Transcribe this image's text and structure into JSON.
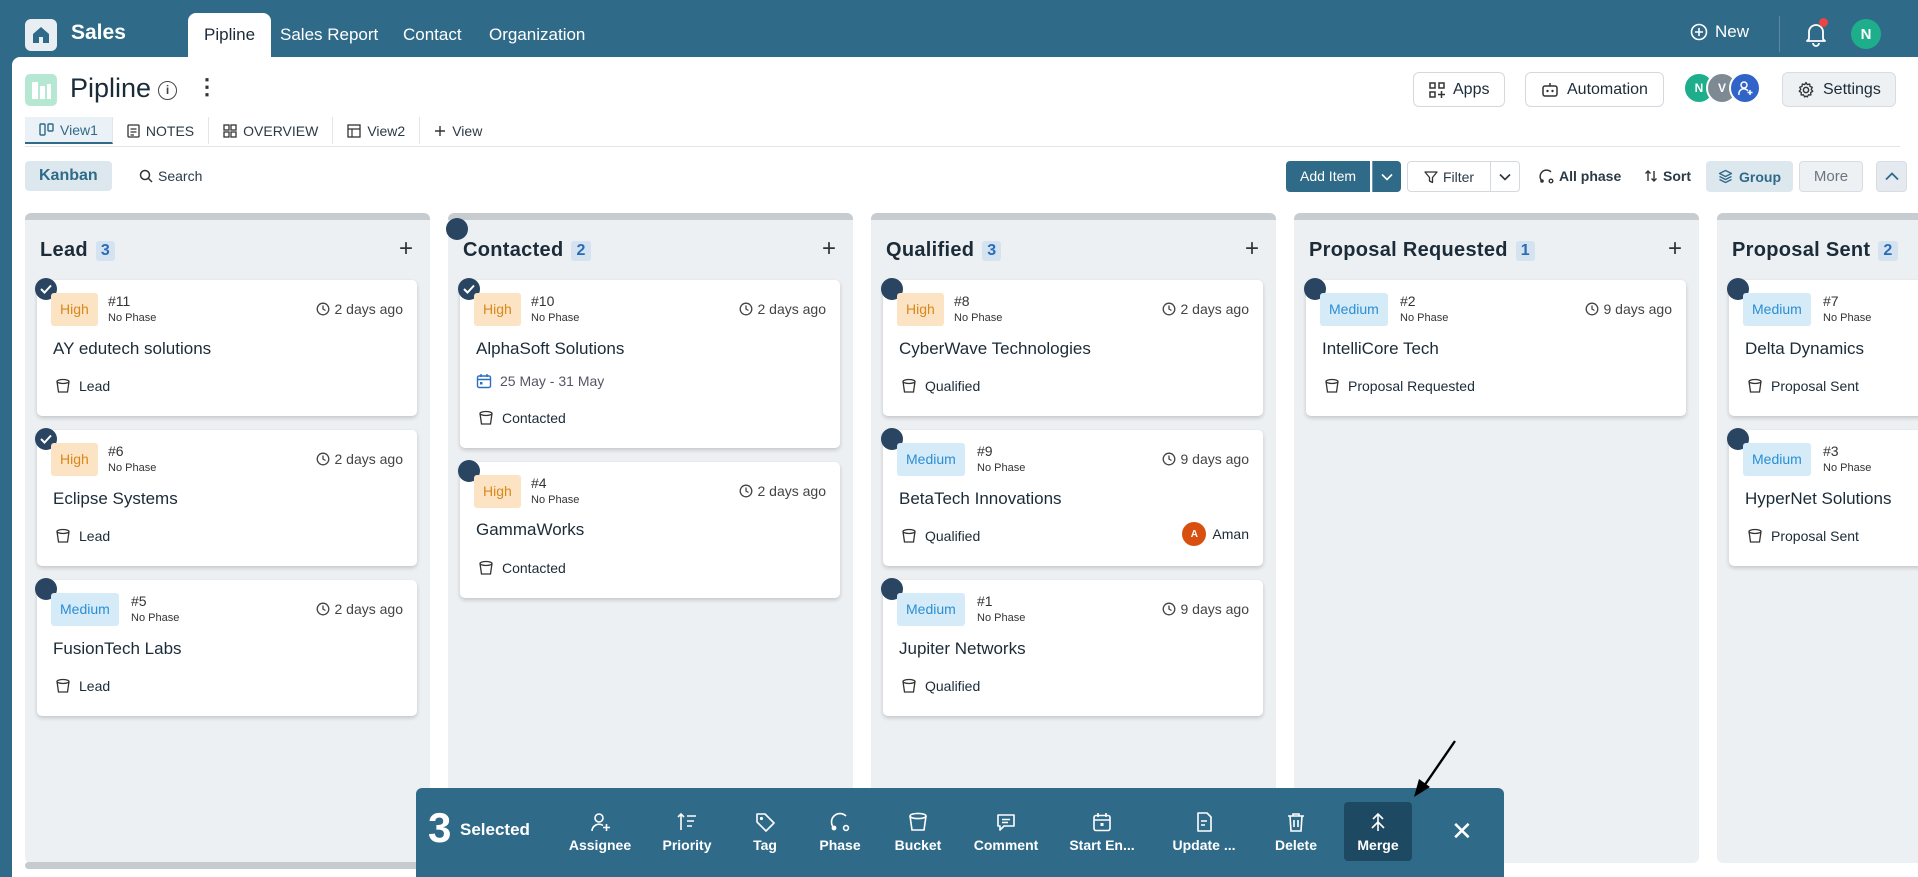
{
  "app": {
    "title": "Sales"
  },
  "nav": {
    "tabs": [
      "Pipline",
      "Sales Report",
      "Contact",
      "Organization"
    ],
    "active_tab": "Pipline",
    "new_label": "New",
    "user_initial": "N"
  },
  "page": {
    "title": "Pipline",
    "apps_label": "Apps",
    "automation_label": "Automation",
    "settings_label": "Settings",
    "team_initials": [
      "N",
      "V"
    ]
  },
  "view_tabs": [
    {
      "label": "View1",
      "icon": "board-icon",
      "active": true
    },
    {
      "label": "NOTES",
      "icon": "notes-icon",
      "active": false
    },
    {
      "label": "OVERVIEW",
      "icon": "grid-icon",
      "active": false
    },
    {
      "label": "View2",
      "icon": "table-icon",
      "active": false
    },
    {
      "label": "View",
      "icon": "plus-icon",
      "active": false
    }
  ],
  "toolbar": {
    "kanban": "Kanban",
    "search": "Search",
    "add_item": "Add Item",
    "filter": "Filter",
    "all_phase": "All phase",
    "sort": "Sort",
    "group": "Group",
    "more": "More"
  },
  "columns": [
    {
      "name": "Lead",
      "count": "3",
      "cards": [
        {
          "priority": "High",
          "id": "#11",
          "phase": "No Phase",
          "time": "2 days ago",
          "name": "AY edutech solutions",
          "bucket": "Lead",
          "selected": true
        },
        {
          "priority": "High",
          "id": "#6",
          "phase": "No Phase",
          "time": "2 days ago",
          "name": "Eclipse Systems",
          "bucket": "Lead",
          "selected": true
        },
        {
          "priority": "Medium",
          "id": "#5",
          "phase": "No Phase",
          "time": "2 days ago",
          "name": "FusionTech Labs",
          "bucket": "Lead",
          "selected": false
        }
      ]
    },
    {
      "name": "Contacted",
      "count": "2",
      "cards": [
        {
          "priority": "High",
          "id": "#10",
          "phase": "No Phase",
          "time": "2 days ago",
          "name": "AlphaSoft Solutions",
          "dates": "25 May  -  31 May",
          "bucket": "Contacted",
          "selected": true
        },
        {
          "priority": "High",
          "id": "#4",
          "phase": "No Phase",
          "time": "2 days ago",
          "name": "GammaWorks",
          "bucket": "Contacted",
          "selected": false
        }
      ]
    },
    {
      "name": "Qualified",
      "count": "3",
      "cards": [
        {
          "priority": "High",
          "id": "#8",
          "phase": "No Phase",
          "time": "2 days ago",
          "name": "CyberWave Technologies",
          "bucket": "Qualified",
          "selected": false
        },
        {
          "priority": "Medium",
          "id": "#9",
          "phase": "No Phase",
          "time": "9 days ago",
          "name": "BetaTech Innovations",
          "bucket": "Qualified",
          "assignee": "Aman",
          "assignee_initial": "A",
          "selected": false
        },
        {
          "priority": "Medium",
          "id": "#1",
          "phase": "No Phase",
          "time": "9 days ago",
          "name": "Jupiter Networks",
          "bucket": "Qualified",
          "selected": false
        }
      ]
    },
    {
      "name": "Proposal Requested",
      "count": "1",
      "cards": [
        {
          "priority": "Medium",
          "id": "#2",
          "phase": "No Phase",
          "time": "9 days ago",
          "name": "IntelliCore Tech",
          "bucket": "Proposal Requested",
          "selected": false
        }
      ]
    },
    {
      "name": "Proposal Sent",
      "count": "2",
      "cards": [
        {
          "priority": "Medium",
          "id": "#7",
          "phase": "No Phase",
          "name": "Delta Dynamics",
          "bucket": "Proposal Sent",
          "selected": false
        },
        {
          "priority": "Medium",
          "id": "#3",
          "phase": "No Phase",
          "name": "HyperNet Solutions",
          "bucket": "Proposal Sent",
          "selected": false
        }
      ]
    }
  ],
  "selection_bar": {
    "count": "3",
    "label": "Selected",
    "actions": [
      "Assignee",
      "Priority",
      "Tag",
      "Phase",
      "Bucket",
      "Comment",
      "Start En...",
      "Update ...",
      "Delete",
      "Merge"
    ],
    "active_action": "Merge"
  },
  "colors": {
    "brand": "#2f6a88",
    "high": "#d9881c",
    "medium": "#2b8ed3",
    "notification": "#e94545"
  }
}
